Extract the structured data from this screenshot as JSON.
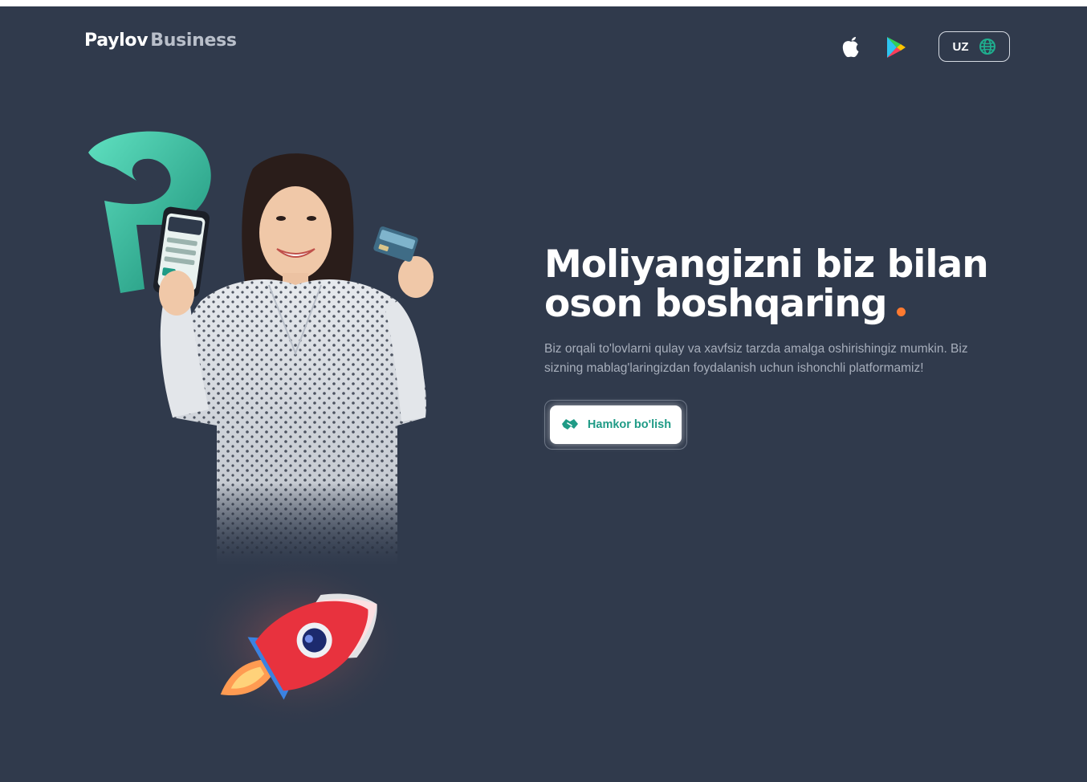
{
  "header": {
    "logo_primary": "Paylov",
    "logo_secondary": "Business",
    "app_store_icon": "apple-icon",
    "play_store_icon": "google-play-icon",
    "language_label": "UZ",
    "language_icon": "globe-icon"
  },
  "hero": {
    "title_line1": "Moliyangizni biz bilan",
    "title_line2": "oson boshqaring",
    "description": "Biz orqali to'lovlarni qulay va xavfsiz tarzda amalga oshirishingiz mumkin. Biz sizning mablag'laringizdan foydalanish uchun ishonchli platformamiz!",
    "cta_label": "Hamkor bo'lish",
    "cta_icon": "handshake-icon"
  },
  "colors": {
    "background": "#303a4c",
    "accent_green": "#1f9b86",
    "accent_orange": "#ff7a30",
    "text_muted": "#a7aebb"
  }
}
